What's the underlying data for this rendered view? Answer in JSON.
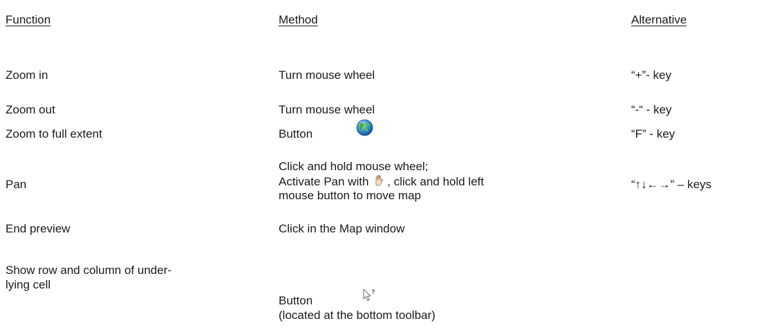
{
  "headers": {
    "function": "Function",
    "method": "Method",
    "alternative": "Alternative"
  },
  "rows": [
    {
      "function": "Zoom in",
      "method": "Turn mouse wheel",
      "alternative": "“+”- key"
    },
    {
      "function": "Zoom out",
      "method": "Turn mouse wheel",
      "alternative": "“-“ - key"
    },
    {
      "function": "Zoom to full extent",
      "method": "Button",
      "alternative": "“F” - key",
      "icon": "globe-icon"
    },
    {
      "function": "Pan",
      "method_line1": "Click and hold mouse wheel;",
      "method_line2_pre": "Activate Pan with",
      "method_line2_post": ", click and hold left",
      "method_line3": "mouse button to move map",
      "alternative": "“↑↓←→” – keys",
      "icon": "hand-pan-icon"
    },
    {
      "function": "End preview",
      "method": "Click in the Map window",
      "alternative": ""
    },
    {
      "function_line1": "Show row and column of under-",
      "function_line2": "lying cell",
      "method_line1": "Button",
      "method_line2": "(located at the bottom toolbar)",
      "alternative": "",
      "icon": "cursor-query-icon"
    }
  ]
}
